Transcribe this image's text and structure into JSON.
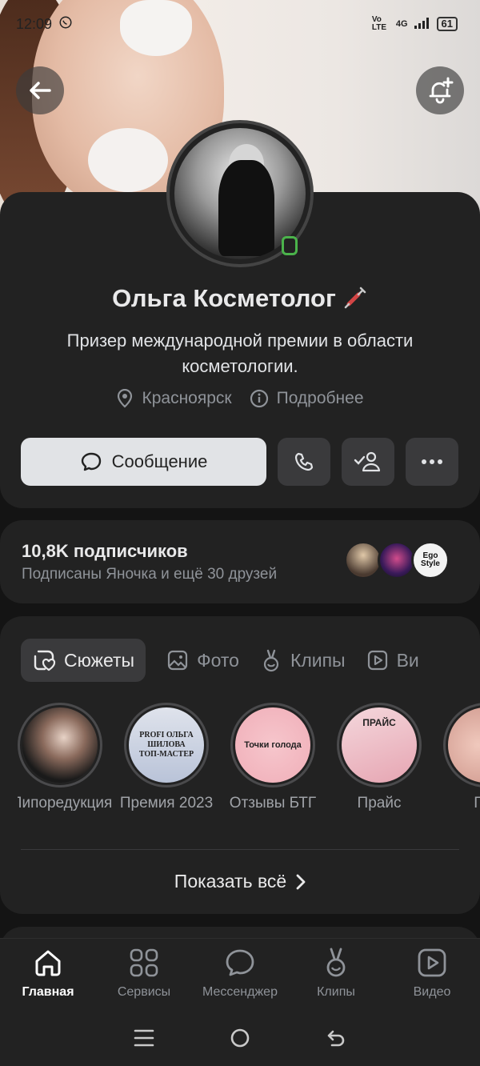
{
  "status_bar": {
    "time": "12:09",
    "network": "4G",
    "volte": "Vo LTE",
    "battery": "61"
  },
  "profile": {
    "name": "Ольга Косметолог",
    "bio": "Призер международной премии в области косметологии.",
    "city": "Красноярск",
    "details_label": "Подробнее",
    "message_button": "Сообщение",
    "online": true
  },
  "subscribers": {
    "count_label": "10,8K подписчиков",
    "friends_label": "Подписаны Яночка и ещё 30 друзей",
    "friend_avatar_3_text": "Ego Style"
  },
  "tabs": [
    {
      "label": "Сюжеты",
      "icon": "heart-square-icon",
      "active": true
    },
    {
      "label": "Фото",
      "icon": "image-icon",
      "active": false
    },
    {
      "label": "Клипы",
      "icon": "clips-icon",
      "active": false
    },
    {
      "label": "Ви",
      "icon": "video-icon",
      "active": false
    }
  ],
  "stories": [
    {
      "label": "Липоредукция",
      "image_text": ""
    },
    {
      "label": "Премия 2023",
      "image_text": "PROFI ОЛЬГА ШИЛОВА ТОП-МАСТЕР"
    },
    {
      "label": "Отзывы БТГ",
      "image_text": "Точки голода"
    },
    {
      "label": "Прайс",
      "image_text": "ПРАЙС"
    },
    {
      "label": "Губ",
      "image_text": ""
    }
  ],
  "show_all_label": "Показать всё",
  "bottom_nav": [
    {
      "label": "Главная",
      "icon": "home-icon",
      "active": true
    },
    {
      "label": "Сервисы",
      "icon": "services-icon",
      "active": false
    },
    {
      "label": "Мессенджер",
      "icon": "messenger-icon",
      "active": false
    },
    {
      "label": "Клипы",
      "icon": "clips-icon",
      "active": false
    },
    {
      "label": "Видео",
      "icon": "video-icon",
      "active": false
    }
  ],
  "colors": {
    "background": "#141414",
    "card": "#222222",
    "accent_online": "#4bb34b",
    "button_light": "#e1e3e6"
  }
}
